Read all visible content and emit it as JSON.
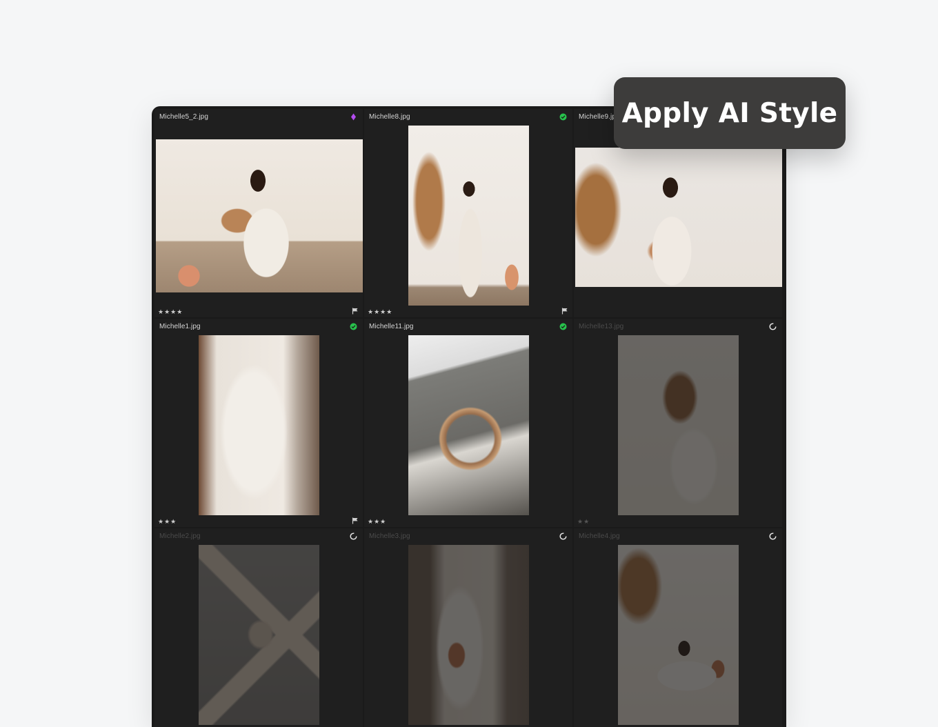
{
  "tooltip": {
    "label": "Apply AI Style"
  },
  "photos": [
    {
      "filename": "Michelle5_2.jpg",
      "status": "ai-diamond",
      "rating_text": "★★★★",
      "rating": 4,
      "flag": true,
      "dim": false
    },
    {
      "filename": "Michelle8.jpg",
      "status": "done-check",
      "rating_text": "★★★★",
      "rating": 4,
      "flag": true,
      "dim": false
    },
    {
      "filename": "Michelle9.jpg",
      "status": "none",
      "rating_text": "",
      "rating": 0,
      "flag": false,
      "dim": false
    },
    {
      "filename": "Michelle1.jpg",
      "status": "done-check",
      "rating_text": "★★★",
      "rating": 3,
      "flag": true,
      "dim": false
    },
    {
      "filename": "Michelle11.jpg",
      "status": "done-check",
      "rating_text": "★★★",
      "rating": 3,
      "flag": false,
      "dim": false
    },
    {
      "filename": "Michelle13.jpg",
      "status": "processing-spinner",
      "rating_text": "★★",
      "rating": 2,
      "flag": false,
      "dim": true
    },
    {
      "filename": "Michelle2.jpg",
      "status": "processing-spinner",
      "rating_text": "",
      "rating": 0,
      "flag": false,
      "dim": true
    },
    {
      "filename": "Michelle3.jpg",
      "status": "processing-spinner",
      "rating_text": "",
      "rating": 0,
      "flag": false,
      "dim": true
    },
    {
      "filename": "Michelle4.jpg",
      "status": "processing-spinner",
      "rating_text": "",
      "rating": 0,
      "flag": false,
      "dim": true
    }
  ],
  "colors": {
    "accent_check": "#27c24c",
    "accent_diamond": "#b44cf0",
    "panel_bg": "#1a1a1a",
    "tooltip_bg": "#3d3c3b"
  }
}
